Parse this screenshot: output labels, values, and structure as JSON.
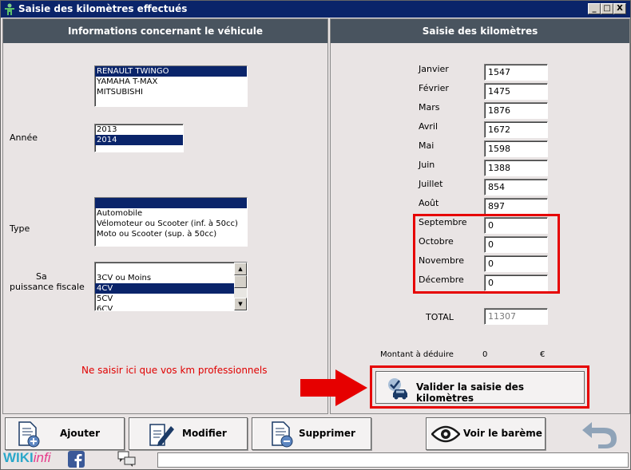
{
  "window": {
    "title": "Saisie des kilomètres effectués",
    "controls": [
      "_",
      "□",
      "X"
    ]
  },
  "left_panel": {
    "header": "Informations concernant le véhicule",
    "vehicles": [
      {
        "label": "RENAULT TWINGO",
        "selected": true
      },
      {
        "label": "YAMAHA T-MAX",
        "selected": false
      },
      {
        "label": "MITSUBISHI",
        "selected": false
      }
    ],
    "year_label": "Année",
    "years": [
      {
        "label": "2013",
        "selected": false
      },
      {
        "label": "2014",
        "selected": true
      }
    ],
    "type_label": "Type",
    "types": [
      {
        "label": "",
        "selected": true
      },
      {
        "label": "Automobile",
        "selected": false
      },
      {
        "label": "Vélomoteur ou Scooter (inf. à 50cc)",
        "selected": false
      },
      {
        "label": "Moto ou Scooter  (sup. à 50cc)",
        "selected": false
      }
    ],
    "power_label_line1": "Sa",
    "power_label_line2": "puissance fiscale",
    "powers": [
      {
        "label": "",
        "selected": false
      },
      {
        "label": "3CV ou Moins",
        "selected": false
      },
      {
        "label": "4CV",
        "selected": true
      },
      {
        "label": "5CV",
        "selected": false
      },
      {
        "label": "6CV",
        "selected": false
      }
    ],
    "warning": "Ne saisir ici que vos km professionnels",
    "warning_color": "#e00000"
  },
  "right_panel": {
    "header": "Saisie des kilomètres",
    "months": [
      {
        "label": "Janvier",
        "value": "1547"
      },
      {
        "label": "Février",
        "value": "1475"
      },
      {
        "label": "Mars",
        "value": "1876"
      },
      {
        "label": "Avril",
        "value": "1672"
      },
      {
        "label": "Mai",
        "value": "1598"
      },
      {
        "label": "Juin",
        "value": "1388"
      },
      {
        "label": "Juillet",
        "value": "854"
      },
      {
        "label": "Août",
        "value": "897"
      },
      {
        "label": "Septembre",
        "value": "0"
      },
      {
        "label": "Octobre",
        "value": "0"
      },
      {
        "label": "Novembre",
        "value": "0"
      },
      {
        "label": "Décembre",
        "value": "0"
      }
    ],
    "total_label": "TOTAL",
    "total_value": "11307",
    "deduct_label": "Montant à déduire",
    "deduct_value": "0",
    "deduct_currency": "€",
    "validate_button": "Valider la saisie des kilomètres"
  },
  "toolbar": {
    "add_label": "Ajouter",
    "modify_label": "Modifier",
    "delete_label": "Supprimer",
    "scale_label": "Voir le barème"
  },
  "footer": {
    "logo_wiki": "WIKI",
    "logo_infi": "infi",
    "status_text": ""
  },
  "colors": {
    "title_bar": "#0a246a",
    "panel_header": "#49545f",
    "highlight_red": "#e60000",
    "selection": "#0a246a"
  }
}
